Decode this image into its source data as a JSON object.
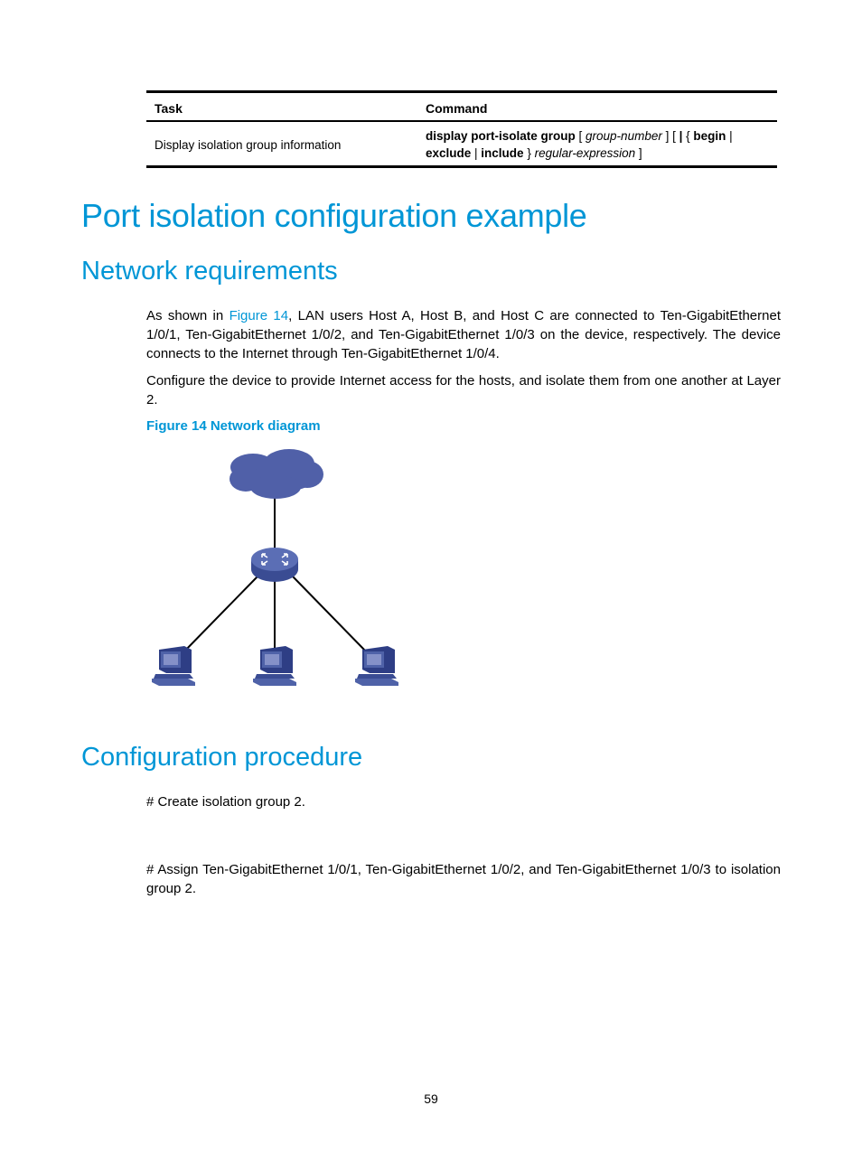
{
  "table": {
    "headers": [
      "Task",
      "Command"
    ],
    "rows": [
      {
        "task": "Display isolation group information",
        "command_parts": {
          "p1_bold": "display port-isolate group",
          "p2": " [ ",
          "p3_italic": "group-number",
          "p4": " ] [ ",
          "p5_bold": "|",
          "p6": " { ",
          "p7_bold": "begin",
          "p8": " |",
          "p9_bold": "exclude",
          "p10": " | ",
          "p11_bold": "include",
          "p12": " } ",
          "p13_italic": "regular-expression",
          "p14": " ]"
        }
      }
    ]
  },
  "headings": {
    "main": "Port isolation configuration example",
    "network_requirements": "Network requirements",
    "configuration_procedure": "Configuration procedure"
  },
  "paragraphs": {
    "p1_before_link": "As shown in ",
    "p1_link": "Figure 14",
    "p1_after_link": ", LAN users Host A, Host B, and Host C are connected to Ten-GigabitEthernet 1/0/1, Ten-GigabitEthernet 1/0/2, and Ten-GigabitEthernet 1/0/3 on the device, respectively. The device connects to the Internet through Ten-GigabitEthernet 1/0/4.",
    "p2": "Configure the device to provide Internet access for the hosts, and isolate them from one another at Layer 2.",
    "step1": "# Create isolation group 2.",
    "step2": "# Assign Ten-GigabitEthernet 1/0/1, Ten-GigabitEthernet 1/0/2, and Ten-GigabitEthernet 1/0/3 to isolation group 2."
  },
  "figure": {
    "caption": "Figure 14 Network diagram",
    "nodes": [
      "internet-cloud",
      "switch",
      "host",
      "host",
      "host"
    ],
    "colors": {
      "device_blue": "#4F62A8",
      "device_dark": "#2E3E85",
      "screen": "#8591C8",
      "line": "#000000"
    }
  },
  "page_number": "59",
  "colors": {
    "accent": "#0096D6",
    "text": "#000000"
  }
}
